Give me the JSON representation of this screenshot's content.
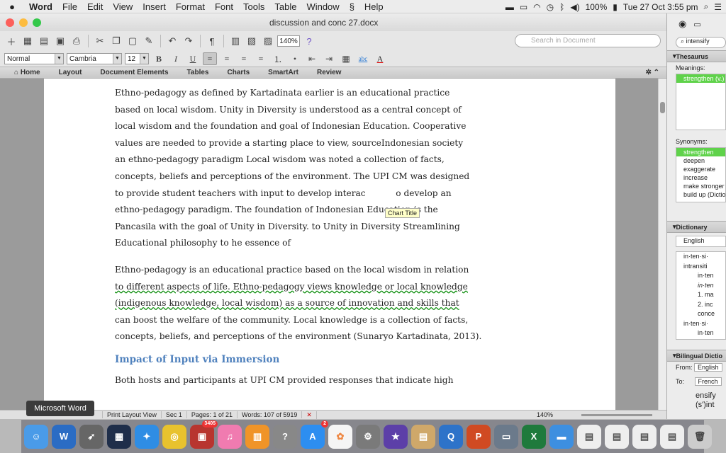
{
  "menubar": {
    "app": "Word",
    "items": [
      "File",
      "Edit",
      "View",
      "Insert",
      "Format",
      "Font",
      "Tools",
      "Table",
      "Window",
      "Help"
    ],
    "battery": "100%",
    "clock": "Tue 27 Oct  3:55 pm"
  },
  "window": {
    "title": "discussion and conc 27.docx",
    "zoom": "140%",
    "search_placeholder": "Search in Document"
  },
  "format": {
    "style": "Normal",
    "font": "Cambria",
    "size": "12"
  },
  "ribbon": {
    "tabs": [
      "Home",
      "Layout",
      "Document Elements",
      "Tables",
      "Charts",
      "SmartArt",
      "Review"
    ]
  },
  "doc": {
    "para1": [
      "Ethno-pedagogy as defined by Kartadinata earlier is an educational practice",
      "based on local wisdom.  Unity in Diversity is understood as a central concept of",
      "local wisdom and the foundation and goal of Indonesian Education. Cooperative",
      "values are needed to provide a starting place to view, sourceIndonesian society",
      "an ethno-pedagogy paradigm Local wisdom was noted a collection of facts,",
      "concepts, beliefs and perceptions of the environment.  The UPI CM was designed",
      "to provide student teachers with input to develop interac           o develop an",
      "ethno-pedagogy paradigm.  The foundation of Indonesian Education is the",
      "Pancasila with the goal of Unity in Diversity. to Unity in Diversity Streamlining",
      "Educational  philosophy to he essence of"
    ],
    "para2": [
      "Ethno-pedagogy is an educational practice based on the local wisdom in relation",
      "to different aspects of life. Ethno-pedagogy views knowledge or local knowledge",
      "(indigenous knowledge, local wisdom) as a source of innovation and skills that",
      "can boost the welfare of the community. Local knowledge is a collection of facts,",
      "concepts, beliefs, and perceptions of the environment (Sunaryo Kartadinata, 2013)."
    ],
    "heading": "Impact of Input via Immersion",
    "para3": [
      "Both hosts and participants at UPI CM provided responses that indicate high"
    ],
    "tooltip": "Chart Title"
  },
  "status": {
    "app_label": "Microsoft Word",
    "view": "Print Layout View",
    "sec_label": "Sec",
    "sec": "1",
    "pages_label": "Pages:",
    "pages": "1 of 21",
    "words_label": "Words:",
    "words": "107 of 5919",
    "zoom": "140%"
  },
  "sidebar": {
    "search": "intensify",
    "thesaurus": "Thesaurus",
    "meanings_label": "Meanings:",
    "meanings": [
      "strengthen (v.)"
    ],
    "synonyms_label": "Synonyms:",
    "synonyms": [
      "strengthen",
      "deepen",
      "exaggerate",
      "increase",
      "make stronger",
      "build up (Dictio"
    ],
    "dictionary": "Dictionary",
    "dict_lang": "English",
    "dict_entries": [
      "in·ten·si·",
      "intransiti",
      "in·ten",
      "in·ten",
      "1. ma",
      "2. inc",
      "conce",
      "in·ten·si·",
      "in·ten"
    ],
    "bilingual": "Bilingual Dictio",
    "from_label": "From:",
    "from": "English",
    "to_label": "To:",
    "to": "French",
    "snippet": [
      "ensify",
      "(s')int"
    ]
  },
  "dock": {
    "apps": [
      "Finder",
      "Word",
      "Launchpad",
      "Mission Control",
      "Safari",
      "Chrome",
      "Photo Booth",
      "iTunes",
      "iBooks",
      "Help",
      "App Store",
      "Photos",
      "System Preferences",
      "iMovie",
      "Preview",
      "QuickTime",
      "PowerPoint",
      "Image Capture",
      "Excel",
      "Folder",
      "Document",
      "Document",
      "Document",
      "Document",
      "Trash"
    ],
    "badges": {
      "photobooth": "3405",
      "appstore": "2"
    }
  }
}
